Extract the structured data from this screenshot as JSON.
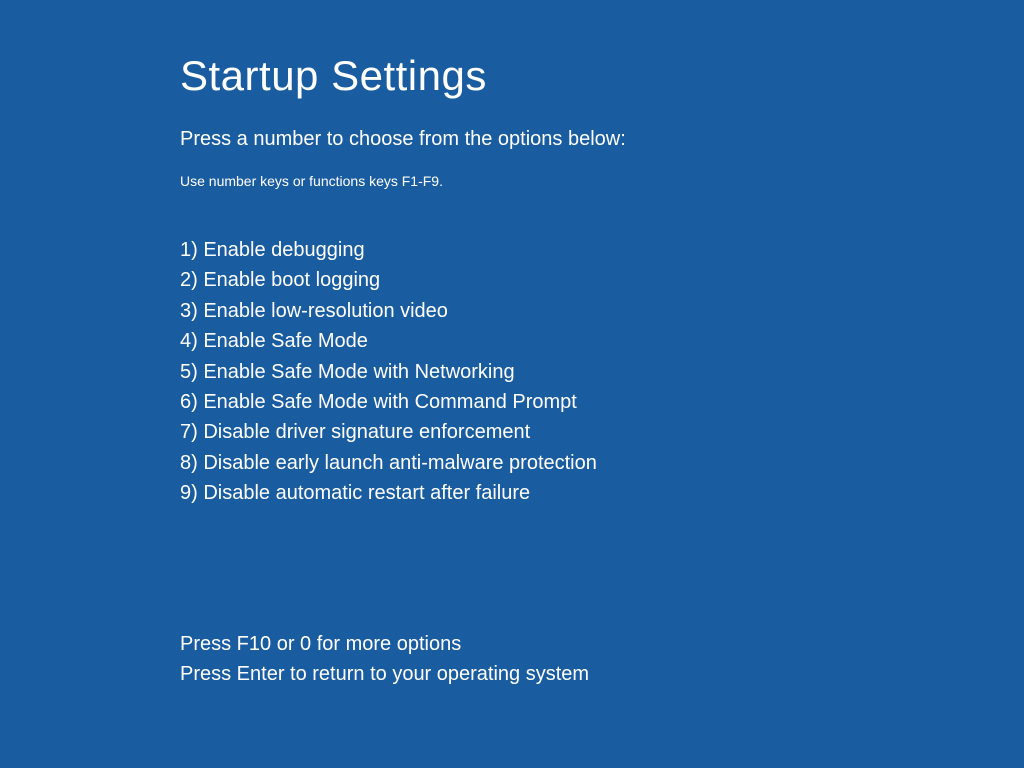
{
  "title": "Startup Settings",
  "subtitle": "Press a number to choose from the options below:",
  "hint": "Use number keys or functions keys F1-F9.",
  "options": [
    "1) Enable debugging",
    "2) Enable boot logging",
    "3) Enable low-resolution video",
    "4) Enable Safe Mode",
    "5) Enable Safe Mode with Networking",
    "6) Enable Safe Mode with Command Prompt",
    "7) Disable driver signature enforcement",
    "8) Disable early launch anti-malware protection",
    "9) Disable automatic restart after failure"
  ],
  "footer": {
    "more_options": "Press F10 or 0 for more options",
    "return_hint": "Press Enter to return to your operating system"
  }
}
